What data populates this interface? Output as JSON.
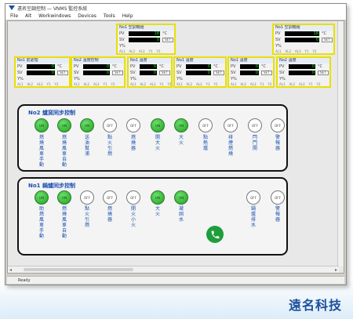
{
  "window": {
    "title": "遠名空調控制 — VNMS 監控系統"
  },
  "menu": [
    "File",
    "Alt",
    "Workwindows",
    "Devices",
    "Tools",
    "Help"
  ],
  "devices": [
    {
      "id": "dev-top-1",
      "name": "No1 空調機組",
      "rows": [
        [
          "PV",
          "18",
          "°C"
        ],
        [
          "SV",
          "0",
          "SET"
        ],
        [
          "Y%",
          "",
          ""
        ]
      ],
      "foot": [
        "AL1",
        "AL2",
        "AL3",
        "Y1",
        "Y2"
      ]
    },
    {
      "id": "dev-top-2",
      "name": "No1 空調機組",
      "rows": [
        [
          "PV",
          "18",
          "°C"
        ],
        [
          "SV",
          "0",
          "SET"
        ],
        [
          "Y%",
          "",
          ""
        ]
      ],
      "foot": [
        "AL1",
        "AL2",
        "AL3",
        "Y1",
        "Y2"
      ]
    },
    {
      "id": "dev-r1",
      "name": "No1 前處理",
      "rows": [
        [
          "PV",
          "0",
          "°C"
        ],
        [
          "SV",
          "0",
          "SET"
        ],
        [
          "Y%",
          "",
          ""
        ]
      ],
      "foot": [
        "AL1",
        "AL2",
        "AL3",
        "Y1",
        "Y2"
      ]
    },
    {
      "id": "dev-r2",
      "name": "No2 溫度控制",
      "rows": [
        [
          "PV",
          "0",
          "°C"
        ],
        [
          "SV",
          "0",
          "SET"
        ],
        [
          "Y%",
          "",
          ""
        ]
      ],
      "foot": [
        "AL1",
        "AL2",
        "AL3",
        "Y1",
        "Y2"
      ]
    },
    {
      "id": "dev-r3",
      "name": "No1 溫度",
      "rows": [
        [
          "PV",
          "0",
          "°C"
        ],
        [
          "SV",
          "0",
          "SET"
        ],
        [
          "Y%",
          "",
          ""
        ]
      ],
      "foot": [
        "AL1",
        "AL2",
        "AL3",
        "Y1",
        "Y2"
      ]
    },
    {
      "id": "dev-r4",
      "name": "No1 溫度",
      "rows": [
        [
          "PV",
          "0",
          "°C"
        ],
        [
          "SV",
          "0",
          "SET"
        ],
        [
          "Y%",
          "",
          ""
        ]
      ],
      "foot": [
        "AL1",
        "AL2",
        "AL3",
        "Y1",
        "Y2"
      ]
    },
    {
      "id": "dev-r5",
      "name": "No1 溫度",
      "rows": [
        [
          "PV",
          "0",
          "°C"
        ],
        [
          "SV",
          "0",
          "SET"
        ],
        [
          "Y%",
          "",
          ""
        ]
      ],
      "foot": [
        "AL1",
        "AL2",
        "AL3",
        "Y1",
        "Y2"
      ]
    },
    {
      "id": "dev-r6",
      "name": "No2 溫度",
      "rows": [
        [
          "PV",
          "0",
          "°C"
        ],
        [
          "SV",
          "0",
          "SET"
        ],
        [
          "Y%",
          "",
          ""
        ]
      ],
      "foot": [
        "AL1",
        "AL2",
        "AL3",
        "Y1",
        "Y2"
      ]
    }
  ],
  "panel_no2": {
    "title": "No2 爐窯同步控制",
    "buttons": [
      {
        "state": "ON",
        "on": true,
        "label": "燃燒風車手動"
      },
      {
        "state": "ON",
        "on": true,
        "label": "燃燒風車自動"
      },
      {
        "state": "ON",
        "on": true,
        "label": "送油幫浦"
      },
      {
        "state": "OFF",
        "on": false,
        "label": "點火引燃"
      },
      {
        "state": "OFF",
        "on": false,
        "label": "燃燒器"
      },
      {
        "state": "ON",
        "on": true,
        "label": "開大火"
      },
      {
        "state": "ON",
        "on": true,
        "label": "大火"
      },
      {
        "state": "OFF",
        "on": false,
        "label": "點熱爐"
      },
      {
        "state": "OFF",
        "on": false,
        "label": "排煙燃燒"
      },
      {
        "state": "OFF",
        "on": false,
        "label": "閂門開"
      },
      {
        "state": "OFF",
        "on": false,
        "label": "警報器"
      }
    ]
  },
  "panel_no1": {
    "title": "No1 鍋爐同步控制",
    "buttons": [
      {
        "state": "ON",
        "on": true,
        "label": "助燃風車手動"
      },
      {
        "state": "ON",
        "on": true,
        "label": "燃燒風車自動"
      },
      {
        "state": "OFF",
        "on": false,
        "label": "點火引燃"
      },
      {
        "state": "OFF",
        "on": false,
        "label": "燃燒器"
      },
      {
        "state": "OFF",
        "on": false,
        "label": "開火小火"
      },
      {
        "state": "ON",
        "on": true,
        "label": "大火"
      },
      {
        "state": "ON",
        "on": true,
        "label": "凝固水"
      },
      {
        "state": "OFF",
        "on": false,
        "label": "鍋爐排水"
      },
      {
        "state": "OFF",
        "on": false,
        "label": "警報器"
      }
    ]
  },
  "statusbar": {
    "text": "Ready"
  },
  "brand": {
    "text": "遠名科技"
  }
}
